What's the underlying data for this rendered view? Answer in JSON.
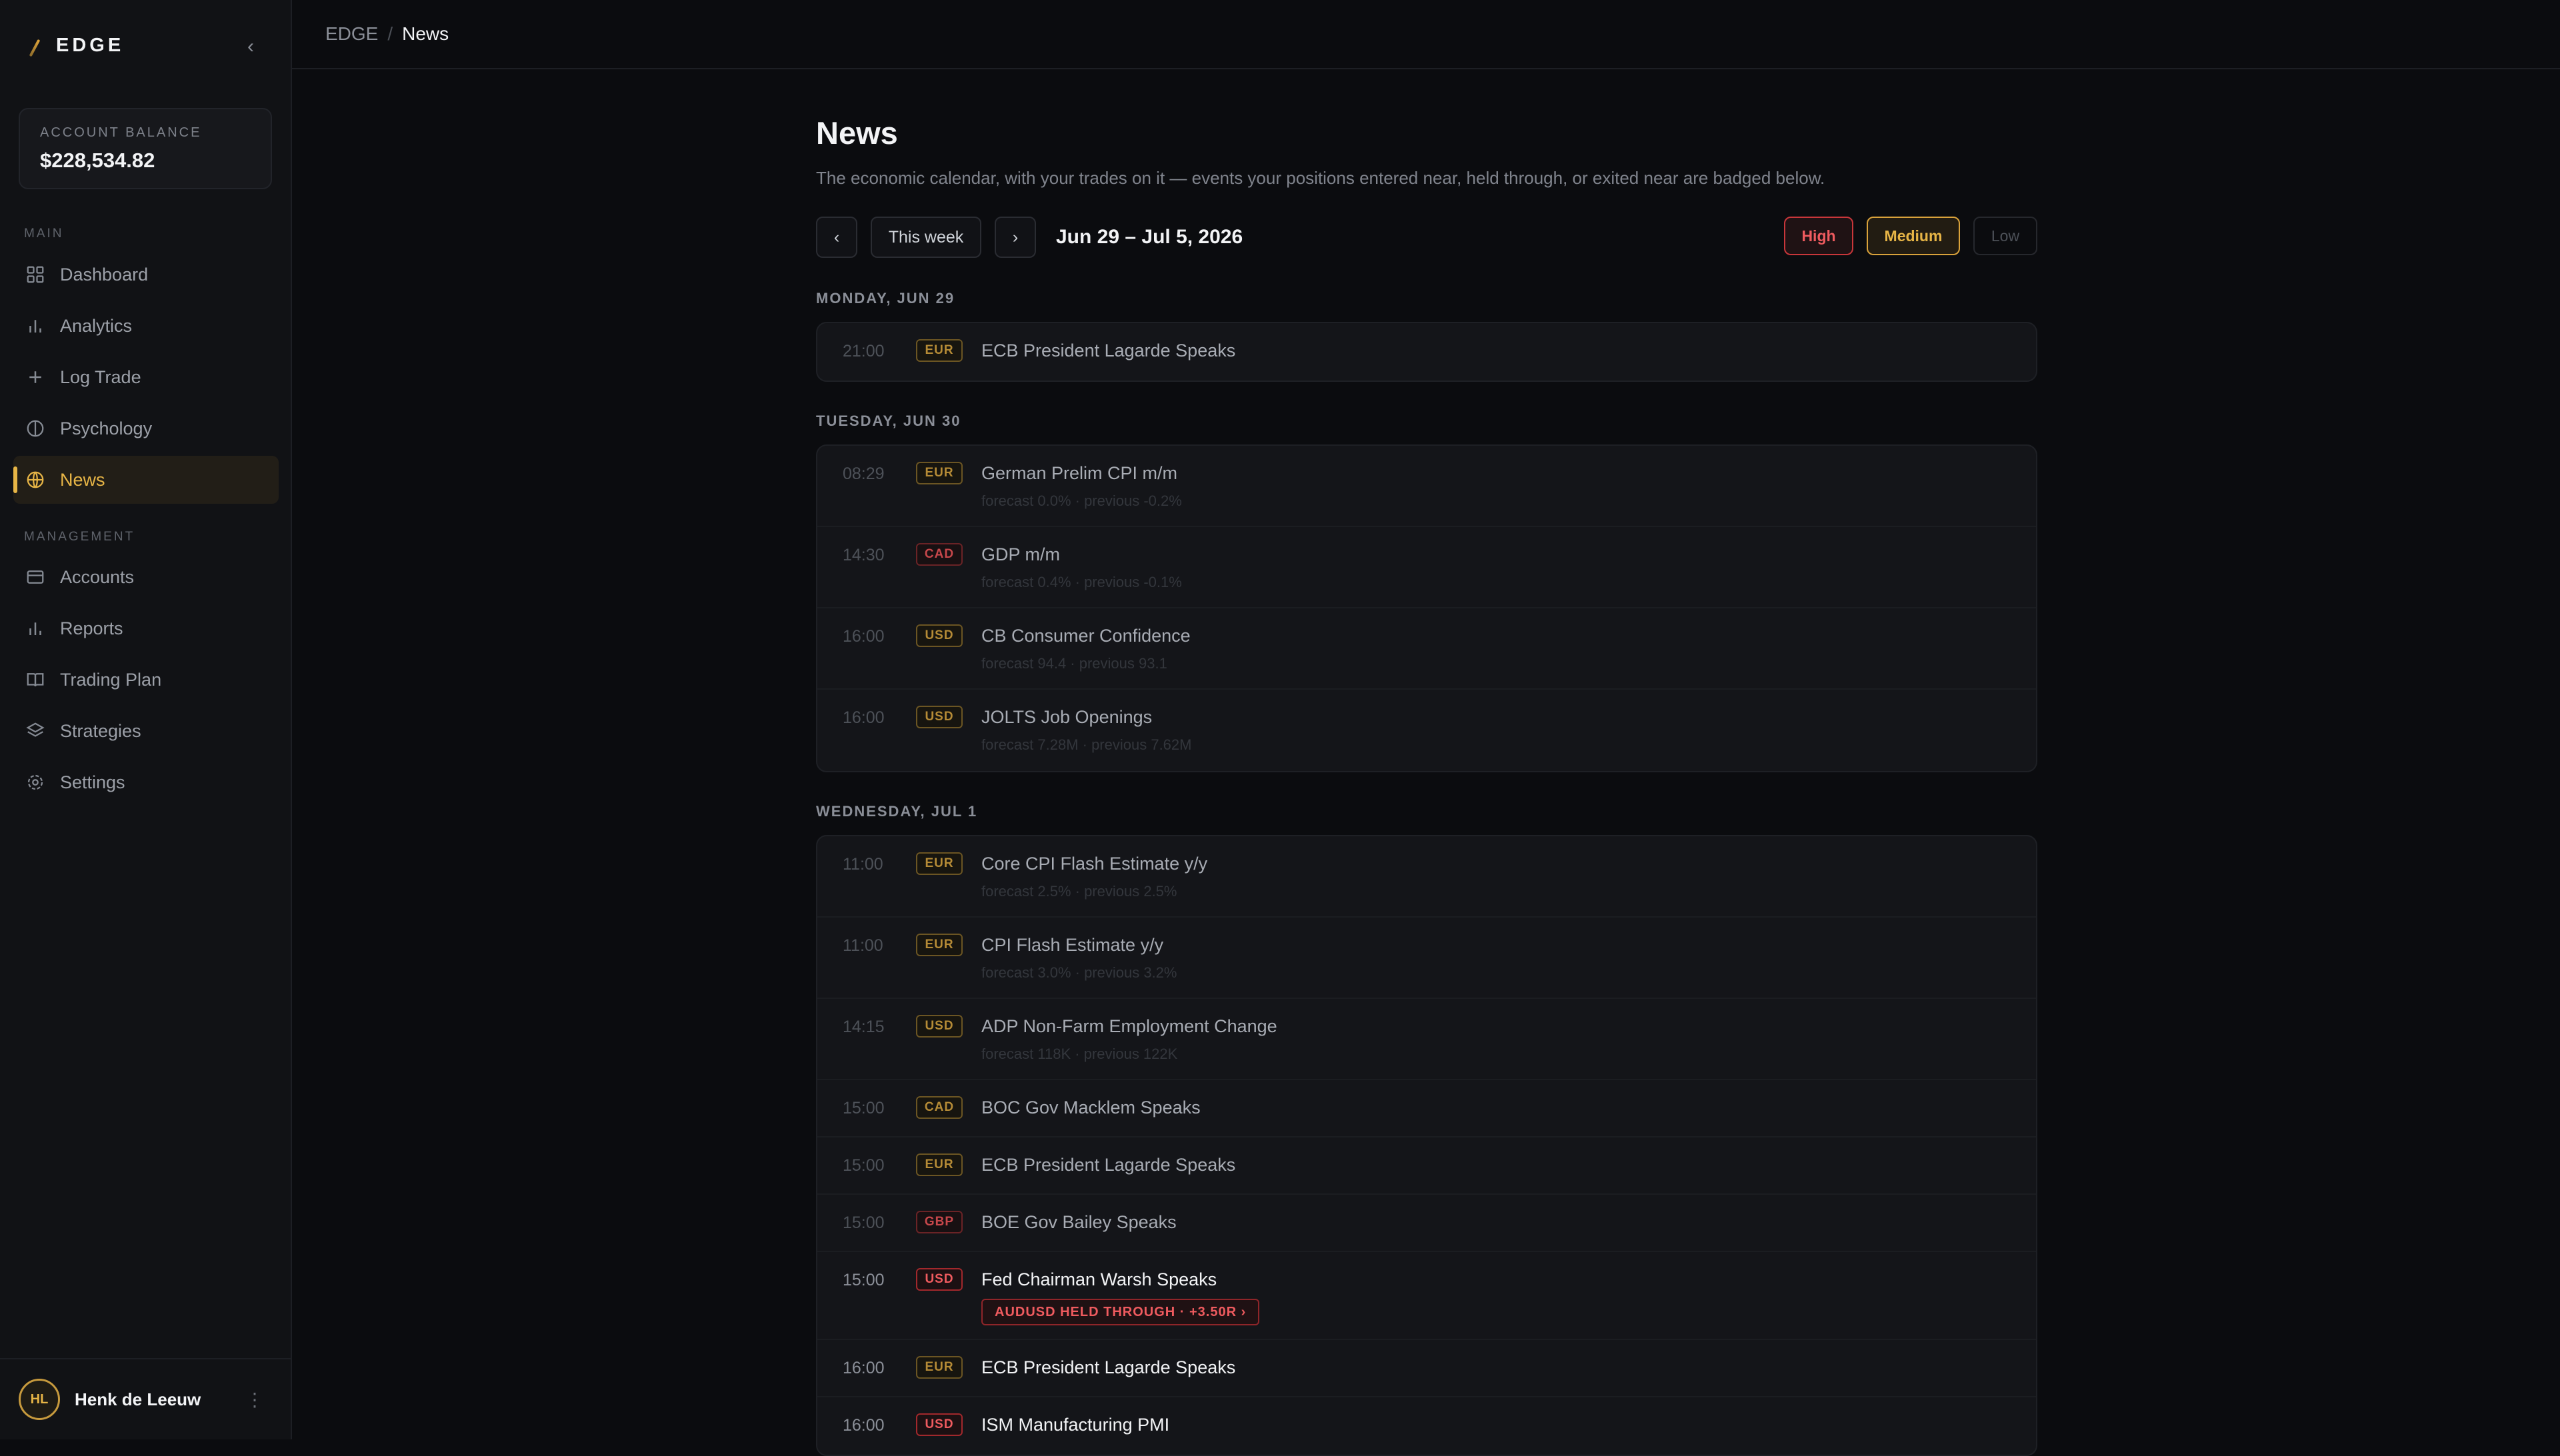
{
  "brand": {
    "name": "EDGE"
  },
  "balance": {
    "label": "ACCOUNT BALANCE",
    "value": "$228,534.82"
  },
  "nav": {
    "main_label": "MAIN",
    "management_label": "MANAGEMENT",
    "main": [
      {
        "label": "Dashboard",
        "icon": "grid-icon"
      },
      {
        "label": "Analytics",
        "icon": "bar-chart-icon"
      },
      {
        "label": "Log Trade",
        "icon": "plus-icon"
      },
      {
        "label": "Psychology",
        "icon": "brain-icon"
      },
      {
        "label": "News",
        "icon": "globe-icon",
        "active": true
      }
    ],
    "management": [
      {
        "label": "Accounts",
        "icon": "card-icon"
      },
      {
        "label": "Reports",
        "icon": "bar-chart-icon"
      },
      {
        "label": "Trading Plan",
        "icon": "book-icon"
      },
      {
        "label": "Strategies",
        "icon": "layers-icon"
      },
      {
        "label": "Settings",
        "icon": "gear-icon"
      }
    ]
  },
  "user": {
    "initials": "HL",
    "name": "Henk de Leeuw"
  },
  "breadcrumb": {
    "root": "EDGE",
    "sep": "/",
    "current": "News"
  },
  "page": {
    "title": "News",
    "subtitle": "The economic calendar, with your trades on it — events your positions entered near, held through, or exited near are badged below."
  },
  "controls": {
    "prev": "‹",
    "this_week": "This week",
    "next": "›",
    "range": "Jun 29 – Jul 5, 2026",
    "filters": {
      "high": "High",
      "medium": "Medium",
      "low": "Low"
    }
  },
  "colors": {
    "accent": "#e7b546",
    "high": "#ef5b5f",
    "medium": "#b58b36"
  },
  "days": [
    {
      "label": "MONDAY, JUN 29",
      "events": [
        {
          "time": "21:00",
          "ccy": "EUR",
          "impact": "medium",
          "title": "ECB President Lagarde Speaks"
        }
      ]
    },
    {
      "label": "TUESDAY, JUN 30",
      "events": [
        {
          "time": "08:29",
          "ccy": "EUR",
          "impact": "medium",
          "title": "German Prelim CPI m/m",
          "meta": "forecast 0.0% · previous -0.2%"
        },
        {
          "time": "14:30",
          "ccy": "CAD",
          "impact": "high",
          "title": "GDP m/m",
          "meta": "forecast 0.4% · previous -0.1%"
        },
        {
          "time": "16:00",
          "ccy": "USD",
          "impact": "medium",
          "title": "CB Consumer Confidence",
          "meta": "forecast 94.4 · previous 93.1"
        },
        {
          "time": "16:00",
          "ccy": "USD",
          "impact": "medium",
          "title": "JOLTS Job Openings",
          "meta": "forecast 7.28M · previous 7.62M"
        }
      ]
    },
    {
      "label": "WEDNESDAY, JUL 1",
      "events": [
        {
          "time": "11:00",
          "ccy": "EUR",
          "impact": "medium",
          "title": "Core CPI Flash Estimate y/y",
          "meta": "forecast 2.5% · previous 2.5%"
        },
        {
          "time": "11:00",
          "ccy": "EUR",
          "impact": "medium",
          "title": "CPI Flash Estimate y/y",
          "meta": "forecast 3.0% · previous 3.2%"
        },
        {
          "time": "14:15",
          "ccy": "USD",
          "impact": "medium",
          "title": "ADP Non-Farm Employment Change",
          "meta": "forecast 118K · previous 122K"
        },
        {
          "time": "15:00",
          "ccy": "CAD",
          "impact": "medium",
          "title": "BOC Gov Macklem Speaks"
        },
        {
          "time": "15:00",
          "ccy": "EUR",
          "impact": "medium",
          "title": "ECB President Lagarde Speaks"
        },
        {
          "time": "15:00",
          "ccy": "GBP",
          "impact": "high",
          "title": "BOE Gov Bailey Speaks"
        },
        {
          "time": "15:00",
          "ccy": "USD",
          "impact": "high",
          "hot": true,
          "title": "Fed Chairman Warsh Speaks",
          "badge": "AUDUSD HELD THROUGH · +3.50R ›"
        },
        {
          "time": "16:00",
          "ccy": "EUR",
          "impact": "medium",
          "hot": true,
          "title": "ECB President Lagarde Speaks"
        },
        {
          "time": "16:00",
          "ccy": "USD",
          "impact": "high",
          "hot": true,
          "title": "ISM Manufacturing PMI"
        }
      ]
    }
  ]
}
